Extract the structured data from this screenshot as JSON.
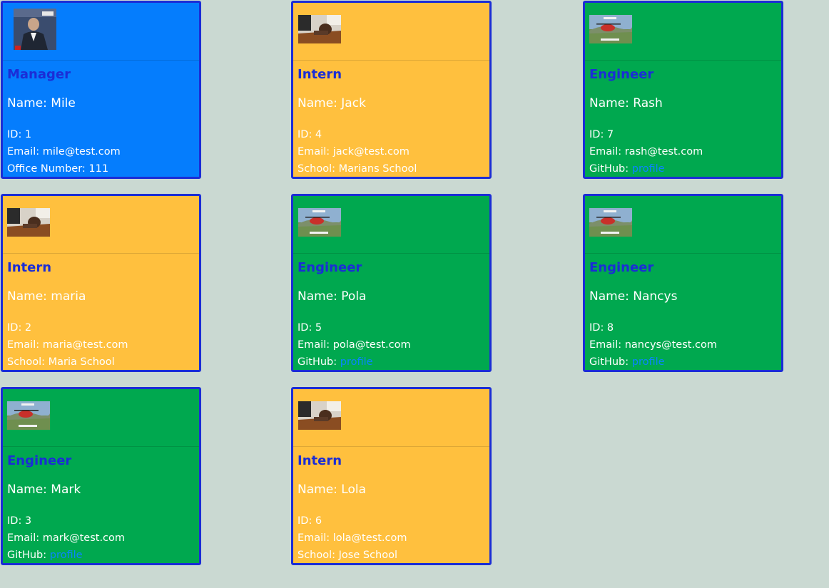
{
  "cards": [
    {
      "role": "Manager",
      "name": "Name: Mile",
      "id_line": "ID: 1",
      "email_line": "Email: mile@test.com",
      "extra_label": "Office Number: 111",
      "extra_link": "",
      "photo": "manager-photo"
    },
    {
      "role": "Intern",
      "name": "Name: Jack",
      "id_line": "ID: 4",
      "email_line": "Email: jack@test.com",
      "extra_label": "School: Marians School",
      "extra_link": "",
      "photo": "intern-photo"
    },
    {
      "role": "Engineer",
      "name": "Name: Rash",
      "id_line": "ID: 7",
      "email_line": "Email: rash@test.com",
      "extra_label": "GitHub: ",
      "extra_link": "profile",
      "photo": "engineer-photo"
    },
    {
      "role": "Intern",
      "name": "Name: maria",
      "id_line": "ID: 2",
      "email_line": "Email: maria@test.com",
      "extra_label": "School: Maria School",
      "extra_link": "",
      "photo": "intern-photo"
    },
    {
      "role": "Engineer",
      "name": "Name: Pola",
      "id_line": "ID: 5",
      "email_line": "Email: pola@test.com",
      "extra_label": "GitHub: ",
      "extra_link": "profile",
      "photo": "engineer-photo"
    },
    {
      "role": "Engineer",
      "name": "Name: Nancys",
      "id_line": "ID: 8",
      "email_line": "Email: nancys@test.com",
      "extra_label": "GitHub: ",
      "extra_link": "profile",
      "photo": "engineer-photo"
    },
    {
      "role": "Engineer",
      "name": "Name: Mark",
      "id_line": "ID: 3",
      "email_line": "Email: mark@test.com",
      "extra_label": "GitHub: ",
      "extra_link": "profile",
      "photo": "engineer-photo"
    },
    {
      "role": "Intern",
      "name": "Name: Lola",
      "id_line": "ID: 6",
      "email_line": "Email: lola@test.com",
      "extra_label": "School: Jose School",
      "extra_link": "",
      "photo": "intern-photo"
    }
  ],
  "colors": {
    "background": "#cad9d2",
    "manager": "#057dfd",
    "intern": "#ffc03e",
    "engineer": "#00a84f",
    "role_text": "#1b2dd6",
    "border": "#1b2dd6",
    "link": "#0a84ff"
  }
}
